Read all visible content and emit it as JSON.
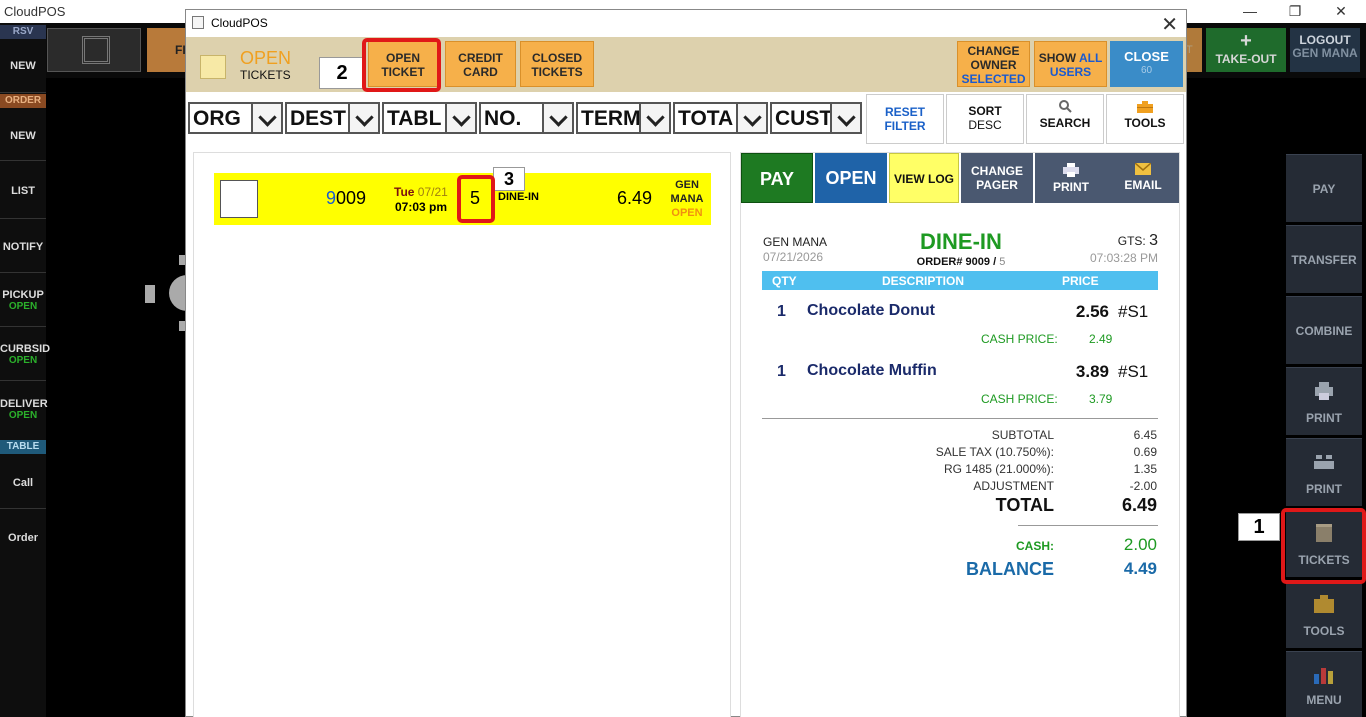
{
  "app": {
    "title": "CloudPOS",
    "min": "—",
    "restore": "❐",
    "close": "✕"
  },
  "left_sidebar": {
    "rsv": "RSV",
    "new1": "NEW",
    "order_hdr": "ORDER",
    "new2": "NEW",
    "list": "LIST",
    "notify": "NOTIFY",
    "pickup": "PICKUP",
    "pickup_sub": "OPEN",
    "curbside": "CURBSID",
    "curbside_sub": "OPEN",
    "delivery": "DELIVER",
    "delivery_sub": "OPEN",
    "table_hdr": "TABLE",
    "call": "Call",
    "order": "Order"
  },
  "top_bar": {
    "orange_partial": "FI",
    "right_partial": "T",
    "takeout_icon": "+",
    "takeout": "TAKE-OUT",
    "logout": "LOGOUT",
    "logout_user": "GEN MANA"
  },
  "right_sidebar": {
    "pay": "PAY",
    "transfer": "TRANSFER",
    "combine": "COMBINE",
    "print1": "PRINT",
    "print2": "PRINT",
    "tickets": "TICKETS",
    "tools": "TOOLS",
    "menu": "MENU"
  },
  "annotations": {
    "step1": "1",
    "step2": "2",
    "step3": "3"
  },
  "dialog": {
    "title": "CloudPOS",
    "close_x": "✕",
    "header_open": "OPEN",
    "header_tickets": "TICKETS",
    "btn_open_ticket_1": "OPEN",
    "btn_open_ticket_2": "TICKET",
    "btn_credit_card_1": "CREDIT",
    "btn_credit_card_2": "CARD",
    "btn_closed_tickets_1": "CLOSED",
    "btn_closed_tickets_2": "TICKETS",
    "btn_change_owner_1": "CHANGE",
    "btn_change_owner_2": "OWNER",
    "btn_change_owner_3": "SELECTED",
    "btn_show_all_1": "SHOW",
    "btn_show_all_2": "ALL",
    "btn_show_all_3": "USERS",
    "btn_close": "CLOSE",
    "btn_close_sub": "60"
  },
  "filters": {
    "org": "ORG",
    "dest": "DEST",
    "tabl": "TABL",
    "no": "NO.",
    "term": "TERM",
    "tota": "TOTA",
    "cust": "CUST",
    "reset_1": "RESET",
    "reset_2": "FILTER",
    "sort_1": "SORT",
    "sort_2": "DESC",
    "search": "SEARCH",
    "tools": "TOOLS"
  },
  "tickets": [
    {
      "number_first": "9",
      "number_rest": "009",
      "day": "Tue",
      "date": "07/21",
      "time": "07:03 pm",
      "table": "5",
      "destination": "DINE-IN",
      "amount": "6.49",
      "user_1": "GEN",
      "user_2": "MANA",
      "status": "OPEN"
    }
  ],
  "detail": {
    "btn_pay": "PAY",
    "btn_open": "OPEN",
    "btn_view_log": "VIEW LOG",
    "btn_change_pager_1": "CHANGE",
    "btn_change_pager_2": "PAGER",
    "btn_print": "PRINT",
    "btn_email": "EMAIL",
    "user": "GEN MANA",
    "date": "07/21/2026",
    "order_type": "DINE-IN",
    "order_label": "ORDER#",
    "order_number": "9009",
    "order_sep": "/",
    "order_table": "5",
    "gts_label": "GTS:",
    "gts_value": "3",
    "time": "07:03:28 PM",
    "col_qty": "QTY",
    "col_desc": "DESCRIPTION",
    "col_price": "PRICE",
    "items": [
      {
        "qty": "1",
        "name": "Chocolate Donut",
        "price": "2.56",
        "seat": "#S1",
        "cash_label": "CASH PRICE:",
        "cash_price": "2.49"
      },
      {
        "qty": "1",
        "name": "Chocolate Muffin",
        "price": "3.89",
        "seat": "#S1",
        "cash_label": "CASH PRICE:",
        "cash_price": "3.79"
      }
    ],
    "subtotal_label": "SUBTOTAL",
    "subtotal": "6.45",
    "tax_label": "SALE TAX (10.750%):",
    "tax": "0.69",
    "rg_label": "RG 1485 (21.000%):",
    "rg": "1.35",
    "adj_label": "ADJUSTMENT",
    "adj": "-2.00",
    "total_label": "TOTAL",
    "total": "6.49",
    "cash_label": "CASH:",
    "cash": "2.00",
    "balance_label": "BALANCE",
    "balance": "4.49"
  },
  "colors": {
    "ticket_row_bg": "#ffff00",
    "order_type": "#1e9a22",
    "highlight": "#e01818",
    "balance": "#1a6aa8"
  }
}
